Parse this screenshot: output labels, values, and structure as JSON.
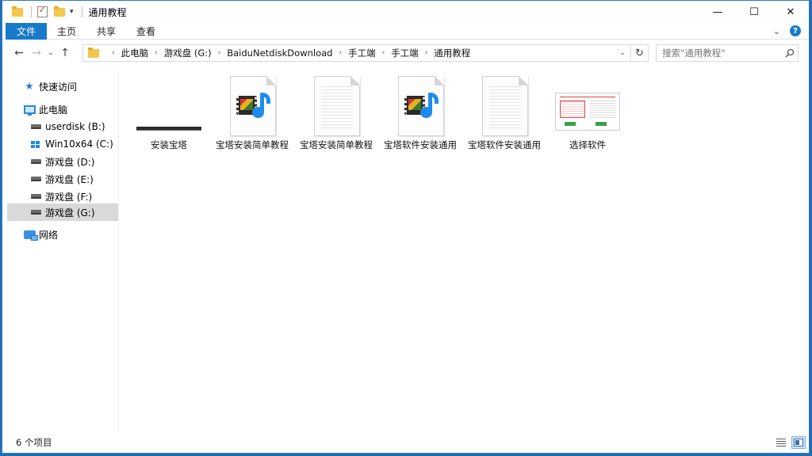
{
  "window": {
    "title": "通用教程",
    "controls": {
      "minimize": "—",
      "maximize": "☐",
      "close": "✕"
    }
  },
  "ribbon": {
    "tabs": [
      "文件",
      "主页",
      "共享",
      "查看"
    ],
    "expand_glyph": "⌄",
    "help_glyph": "?"
  },
  "nav": {
    "back": "←",
    "forward": "→",
    "recent": "⌄",
    "up": "↑"
  },
  "address": {
    "crumbs": [
      "此电脑",
      "游戏盘 (G:)",
      "BaiduNetdiskDownload",
      "手工端",
      "手工端",
      "通用教程"
    ],
    "separator": "›",
    "dropdown": "⌄",
    "refresh": "↻"
  },
  "search": {
    "placeholder": "搜索\"通用教程\""
  },
  "sidebar": {
    "quick_access": "快速访问",
    "this_pc": "此电脑",
    "drives": [
      "userdisk (B:)",
      "Win10x64 (C:)",
      "游戏盘 (D:)",
      "游戏盘 (E:)",
      "游戏盘 (F:)",
      "游戏盘 (G:)"
    ],
    "network": "网络"
  },
  "files": [
    {
      "name": "安装宝塔",
      "type": "video-dark",
      "icon": "video-thumbnail"
    },
    {
      "name": "宝塔安装简单教程",
      "type": "media",
      "icon": "media-file-icon"
    },
    {
      "name": "宝塔安装简单教程",
      "type": "doc",
      "icon": "text-document-icon"
    },
    {
      "name": "宝塔软件安装通用",
      "type": "media",
      "icon": "media-file-icon"
    },
    {
      "name": "宝塔软件安装通用",
      "type": "doc",
      "icon": "text-document-icon"
    },
    {
      "name": "选择软件",
      "type": "image",
      "icon": "image-thumbnail"
    }
  ],
  "status": {
    "count": "6 个项目"
  },
  "colors": {
    "accent": "#1979ca",
    "folder": "#f3c64c",
    "selection": "#d9d9d9"
  }
}
